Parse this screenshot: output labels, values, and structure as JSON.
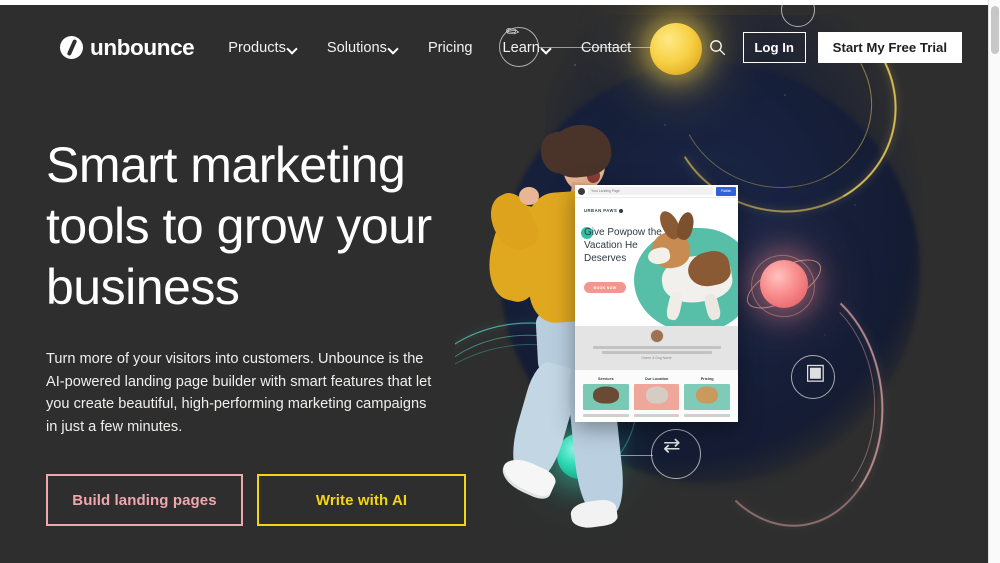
{
  "nav": {
    "logo_text": "unbounce",
    "logo_icon": "unbounce-circle-logo",
    "links": [
      {
        "label": "Products",
        "has_dropdown": true
      },
      {
        "label": "Solutions",
        "has_dropdown": true
      },
      {
        "label": "Pricing",
        "has_dropdown": false
      },
      {
        "label": "Learn",
        "has_dropdown": true
      },
      {
        "label": "Contact",
        "has_dropdown": false
      }
    ],
    "search_icon": "search-icon",
    "login_label": "Log In",
    "trial_label": "Start My Free Trial"
  },
  "hero": {
    "headline": "Smart marketing tools to grow your business",
    "subcopy": "Turn more of your visitors into customers. Unbounce is the AI-powered landing page builder with smart features that let you create beautiful, high-performing marketing campaigns in just a few minutes.",
    "cta_primary": "Build landing pages",
    "cta_secondary": "Write with AI"
  },
  "mockup": {
    "browser_url": "Your Landing Page",
    "browser_button": "Publish",
    "brand": "URBAN PAWS",
    "headline": "Give Powpow the Vacation He Deserves",
    "cta": "BOOK NOW",
    "caption": "Owner & Dog Name",
    "cards": [
      {
        "title": "Services"
      },
      {
        "title": "Our Location"
      },
      {
        "title": "Pricing"
      }
    ]
  },
  "colors": {
    "page_background": "#2e2e2e",
    "hero_art_background": "#16203b",
    "cta_primary_border": "#f0a6ad",
    "cta_secondary_border": "#f5d416",
    "trial_button_background": "#ffffff",
    "mockup_cta": "#f2978d",
    "mockup_accent_teal": "#36bfa0",
    "orb_yellow": "#f6cf3e",
    "orb_teal": "#2fd9b4",
    "orb_pink": "#f98e8e"
  }
}
